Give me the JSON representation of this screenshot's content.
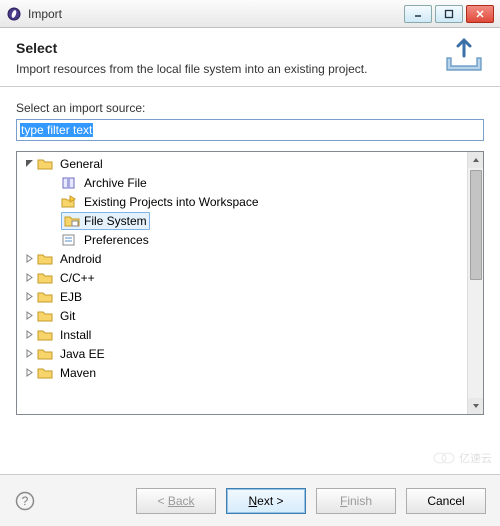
{
  "window": {
    "title": "Import"
  },
  "banner": {
    "heading": "Select",
    "description": "Import resources from the local file system into an existing project."
  },
  "content": {
    "source_label": "Select an import source:",
    "filter_text": "type filter text"
  },
  "tree": {
    "items": [
      {
        "label": "General",
        "expanded": true,
        "level": 0,
        "icon": "folder",
        "children": [
          {
            "label": "Archive File",
            "icon": "archive",
            "selected": false
          },
          {
            "label": "Existing Projects into Workspace",
            "icon": "projects",
            "selected": false
          },
          {
            "label": "File System",
            "icon": "filesystem",
            "selected": true
          },
          {
            "label": "Preferences",
            "icon": "preferences",
            "selected": false
          }
        ]
      },
      {
        "label": "Android",
        "expanded": false,
        "level": 0,
        "icon": "folder"
      },
      {
        "label": "C/C++",
        "expanded": false,
        "level": 0,
        "icon": "folder"
      },
      {
        "label": "EJB",
        "expanded": false,
        "level": 0,
        "icon": "folder"
      },
      {
        "label": "Git",
        "expanded": false,
        "level": 0,
        "icon": "folder"
      },
      {
        "label": "Install",
        "expanded": false,
        "level": 0,
        "icon": "folder"
      },
      {
        "label": "Java EE",
        "expanded": false,
        "level": 0,
        "icon": "folder"
      },
      {
        "label": "Maven",
        "expanded": false,
        "level": 0,
        "icon": "folder"
      }
    ]
  },
  "buttons": {
    "back": "Back",
    "next": "Next >",
    "finish": "Finish",
    "cancel": "Cancel"
  },
  "watermark": "亿速云"
}
